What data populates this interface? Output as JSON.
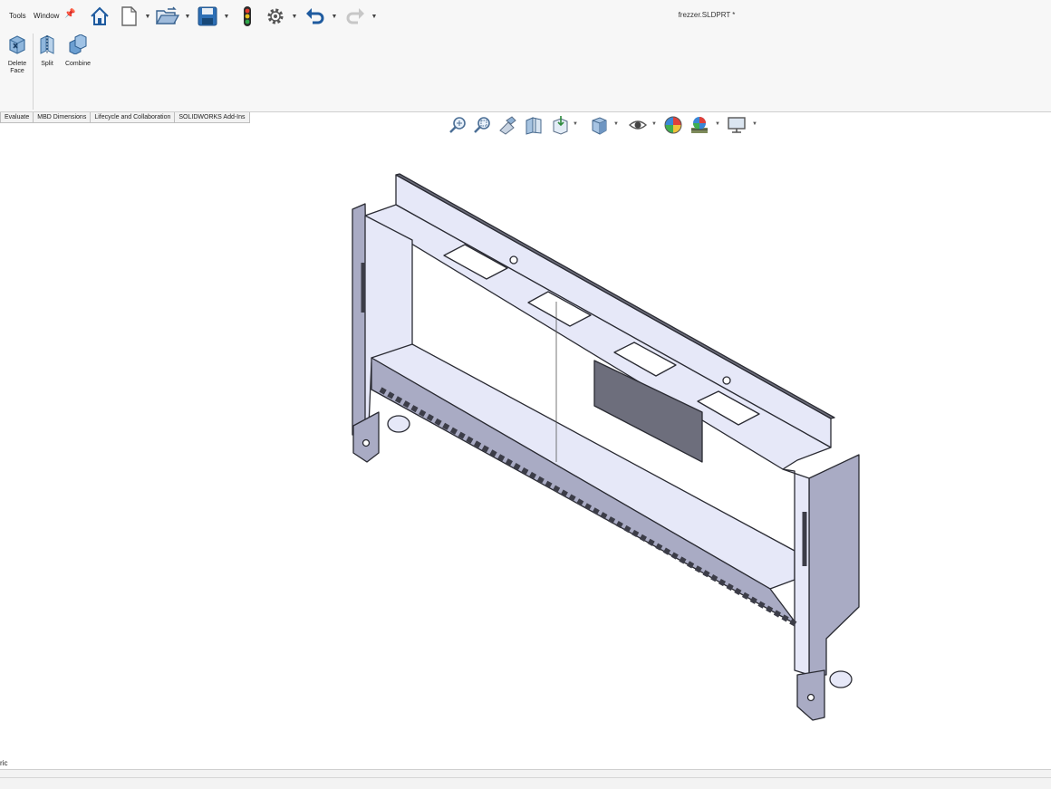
{
  "menu": {
    "tools": "Tools",
    "window": "Window"
  },
  "quick_access": {
    "icons": [
      "home-icon",
      "new-document-icon",
      "open-icon",
      "save-icon",
      "rebuild-traffic-light-icon",
      "options-gear-icon",
      "undo-icon",
      "redo-icon"
    ]
  },
  "document": {
    "title": "frezzer.SLDPRT *"
  },
  "ribbon": {
    "delete_face_label": "Delete\nFace",
    "split_label": "Split",
    "combine_label": "Combine"
  },
  "tabs": {
    "evaluate": "Evaluate",
    "mbd_dimensions": "MBD Dimensions",
    "lifecycle": "Lifecycle and Collaboration",
    "addins": "SOLIDWORKS Add-Ins"
  },
  "view_toolbar": {
    "icons": [
      "zoom-to-fit-icon",
      "zoom-to-area-icon",
      "previous-view-icon",
      "section-view-icon",
      "view-orientation-icon",
      "display-style-icon",
      "hide-show-items-icon",
      "edit-appearance-icon",
      "apply-scene-icon",
      "view-settings-icon"
    ]
  },
  "viewport": {
    "orientation_label": "ric",
    "model_color": "#e6e8f8",
    "model_shadow_color": "#a9abc4",
    "panel_dark_color": "#6d6e7c"
  }
}
